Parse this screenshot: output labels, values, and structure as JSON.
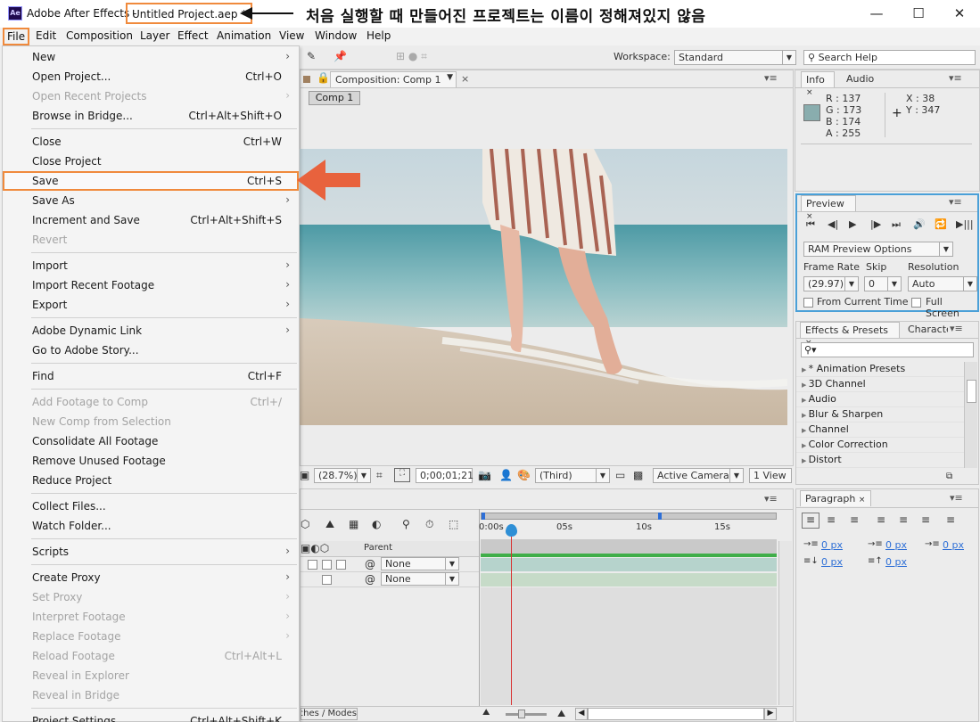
{
  "titlebar": {
    "app_icon": "Ae",
    "app_name": "Adobe After Effects -",
    "file_name": "Untitled Project.aep *",
    "annotation": "처음 실행할 때 만들어진 프로젝트는 이름이 정해져있지 않음",
    "minimize": "—",
    "maximize": "☐",
    "close": "✕"
  },
  "menubar": [
    "File",
    "Edit",
    "Composition",
    "Layer",
    "Effect",
    "Animation",
    "View",
    "Window",
    "Help"
  ],
  "toolbar": {
    "workspace_label": "Workspace:",
    "workspace_value": "Standard",
    "search_placeholder": "Search Help"
  },
  "file_menu": [
    {
      "label": "New",
      "shortcut": "",
      "submenu": true,
      "disabled": false
    },
    {
      "label": "Open Project...",
      "shortcut": "Ctrl+O",
      "submenu": false,
      "disabled": false
    },
    {
      "label": "Open Recent Projects",
      "shortcut": "",
      "submenu": true,
      "disabled": true
    },
    {
      "label": "Browse in Bridge...",
      "shortcut": "Ctrl+Alt+Shift+O",
      "submenu": false,
      "disabled": false
    },
    {
      "label": "Close",
      "shortcut": "Ctrl+W",
      "submenu": false,
      "disabled": false
    },
    {
      "label": "Close Project",
      "shortcut": "",
      "submenu": false,
      "disabled": false
    },
    {
      "label": "Save",
      "shortcut": "Ctrl+S",
      "submenu": false,
      "disabled": false
    },
    {
      "label": "Save As",
      "shortcut": "",
      "submenu": true,
      "disabled": false
    },
    {
      "label": "Increment and Save",
      "shortcut": "Ctrl+Alt+Shift+S",
      "submenu": false,
      "disabled": false
    },
    {
      "label": "Revert",
      "shortcut": "",
      "submenu": false,
      "disabled": true
    },
    {
      "label": "Import",
      "shortcut": "",
      "submenu": true,
      "disabled": false
    },
    {
      "label": "Import Recent Footage",
      "shortcut": "",
      "submenu": true,
      "disabled": false
    },
    {
      "label": "Export",
      "shortcut": "",
      "submenu": true,
      "disabled": false
    },
    {
      "label": "Adobe Dynamic Link",
      "shortcut": "",
      "submenu": true,
      "disabled": false
    },
    {
      "label": "Go to Adobe Story...",
      "shortcut": "",
      "submenu": false,
      "disabled": false
    },
    {
      "label": "Find",
      "shortcut": "Ctrl+F",
      "submenu": false,
      "disabled": false
    },
    {
      "label": "Add Footage to Comp",
      "shortcut": "Ctrl+/",
      "submenu": false,
      "disabled": true
    },
    {
      "label": "New Comp from Selection",
      "shortcut": "",
      "submenu": false,
      "disabled": true
    },
    {
      "label": "Consolidate All Footage",
      "shortcut": "",
      "submenu": false,
      "disabled": false
    },
    {
      "label": "Remove Unused Footage",
      "shortcut": "",
      "submenu": false,
      "disabled": false
    },
    {
      "label": "Reduce Project",
      "shortcut": "",
      "submenu": false,
      "disabled": false
    },
    {
      "label": "Collect Files...",
      "shortcut": "",
      "submenu": false,
      "disabled": false
    },
    {
      "label": "Watch Folder...",
      "shortcut": "",
      "submenu": false,
      "disabled": false
    },
    {
      "label": "Scripts",
      "shortcut": "",
      "submenu": true,
      "disabled": false
    },
    {
      "label": "Create Proxy",
      "shortcut": "",
      "submenu": true,
      "disabled": false
    },
    {
      "label": "Set Proxy",
      "shortcut": "",
      "submenu": true,
      "disabled": true
    },
    {
      "label": "Interpret Footage",
      "shortcut": "",
      "submenu": true,
      "disabled": true
    },
    {
      "label": "Replace Footage",
      "shortcut": "",
      "submenu": true,
      "disabled": true
    },
    {
      "label": "Reload Footage",
      "shortcut": "Ctrl+Alt+L",
      "submenu": false,
      "disabled": true
    },
    {
      "label": "Reveal in Explorer",
      "shortcut": "",
      "submenu": false,
      "disabled": true
    },
    {
      "label": "Reveal in Bridge",
      "shortcut": "",
      "submenu": false,
      "disabled": true
    },
    {
      "label": "Project Settings...",
      "shortcut": "Ctrl+Alt+Shift+K",
      "submenu": false,
      "disabled": false
    }
  ],
  "composition": {
    "tab_label": "Composition: Comp 1",
    "comp_button": "Comp 1",
    "zoom": "(28.7%)",
    "timecode": "0;00;01;21",
    "resolution": "(Third)",
    "camera": "Active Camera",
    "view": "1 View"
  },
  "info": {
    "tab_info": "Info",
    "tab_audio": "Audio",
    "r_label": "R :",
    "r": "137",
    "g_label": "G :",
    "g": "173",
    "b_label": "B :",
    "b": "174",
    "a_label": "A :",
    "a": "255",
    "x_label": "X :",
    "x": "38",
    "y_label": "Y :",
    "y": "347",
    "swatch_color": "#89adae"
  },
  "preview": {
    "tab": "Preview",
    "ram_options": "RAM Preview Options",
    "frame_rate_label": "Frame Rate",
    "skip_label": "Skip",
    "resolution_label": "Resolution",
    "frame_rate": "(29.97)",
    "skip": "0",
    "resolution": "Auto",
    "from_current_time": "From Current Time",
    "full_screen": "Full Screen"
  },
  "effects": {
    "tab": "Effects & Presets",
    "tab2": "Characte",
    "items": [
      "* Animation Presets",
      "3D Channel",
      "Audio",
      "Blur & Sharpen",
      "Channel",
      "Color Correction",
      "Distort"
    ]
  },
  "paragraph": {
    "tab": "Paragraph",
    "v1": "0 px",
    "v2": "0 px",
    "v3": "0 px",
    "v4": "0 px",
    "v5": "0 px"
  },
  "timeline": {
    "ruler": [
      "0:00s",
      "05s",
      "10s",
      "15s"
    ],
    "parent_label": "Parent",
    "parent_values": [
      "None",
      "None"
    ],
    "modes_toggle": "Switches / Modes"
  }
}
